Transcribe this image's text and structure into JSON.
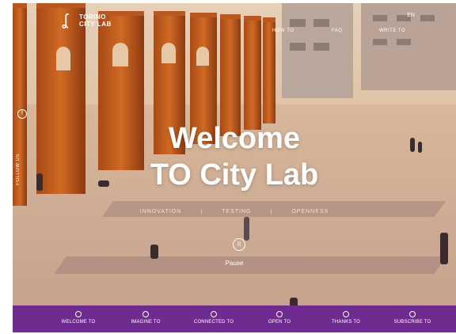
{
  "brand": {
    "line1": "TORINO",
    "line2": "CITY LAB",
    "logo_mark": "ʆ"
  },
  "top_nav": [
    {
      "label": "HOW TO"
    },
    {
      "label": "FAQ"
    },
    {
      "label": "WRITE TO"
    }
  ],
  "language": "EN",
  "side": {
    "follow_label": "FOLLOW US",
    "icon": "f"
  },
  "hero": {
    "line1": "Welcome",
    "line2": "TO City Lab",
    "taglines": [
      "INNOVATION",
      "TESTING",
      "OPENNESS"
    ],
    "separator": "|",
    "pause_icon": "II",
    "pause_label": "Pause"
  },
  "bottom_nav": [
    {
      "label": "WELCOME TO"
    },
    {
      "label": "IMAGINE TO"
    },
    {
      "label": "CONNECTED TO"
    },
    {
      "label": "OPEN TO"
    },
    {
      "label": "THANKS TO"
    },
    {
      "label": "SUBSCRIBE TO"
    }
  ],
  "colors": {
    "purple": "#6f2b8f",
    "pillar": "#c8621f"
  }
}
